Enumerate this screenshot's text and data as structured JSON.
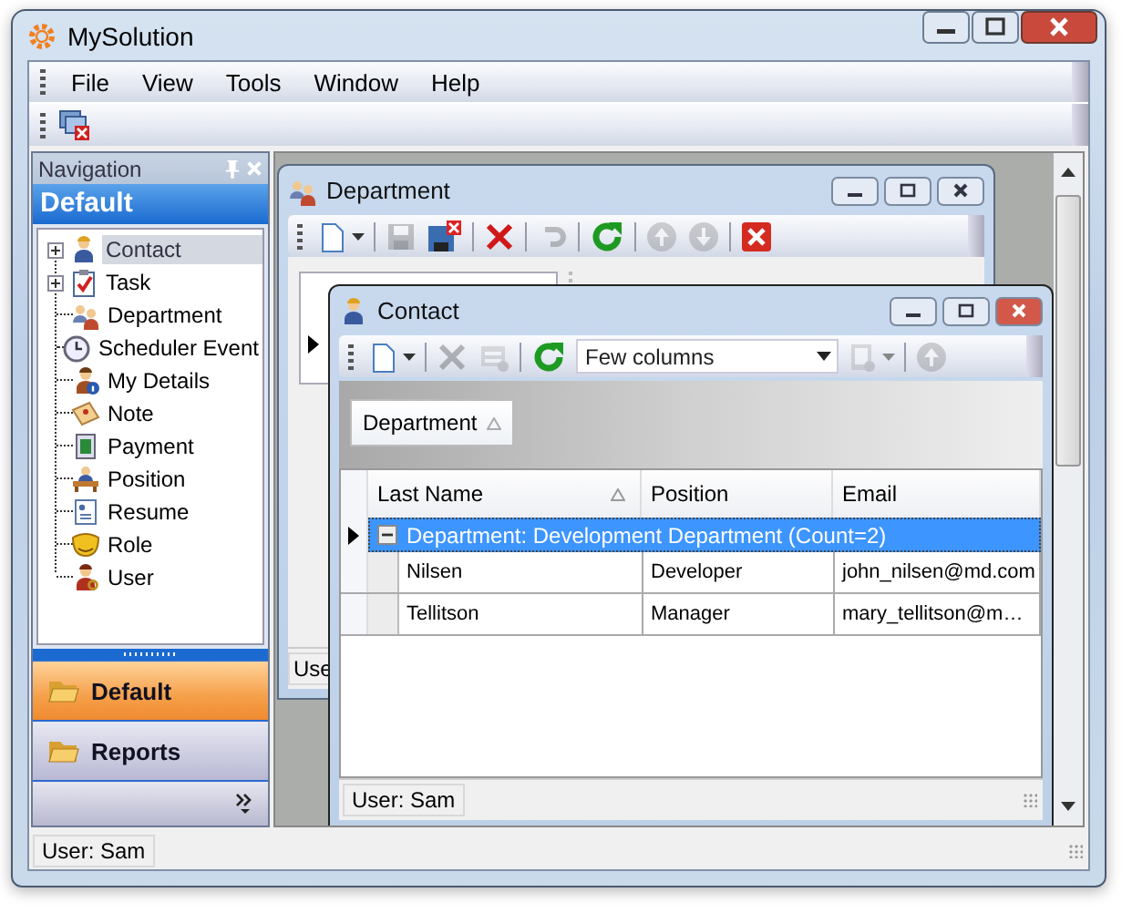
{
  "window": {
    "title": "MySolution"
  },
  "menu": [
    {
      "label": "File"
    },
    {
      "label": "View"
    },
    {
      "label": "Tools"
    },
    {
      "label": "Window"
    },
    {
      "label": "Help"
    }
  ],
  "toolbar": [
    {
      "kind": "close-windows",
      "disabled": false
    }
  ],
  "navigation": {
    "title": "Navigation",
    "group_title": "Default",
    "items": [
      {
        "label": "Contact",
        "kind": "branch",
        "selected": true
      },
      {
        "label": "Task",
        "kind": "branch",
        "selected": false
      },
      {
        "label": "Department",
        "kind": "leaf",
        "selected": false
      },
      {
        "label": "Scheduler Event",
        "kind": "leaf",
        "selected": false
      },
      {
        "label": "My Details",
        "kind": "leaf",
        "selected": false
      },
      {
        "label": "Note",
        "kind": "leaf",
        "selected": false
      },
      {
        "label": "Payment",
        "kind": "leaf",
        "selected": false
      },
      {
        "label": "Position",
        "kind": "leaf",
        "selected": false
      },
      {
        "label": "Resume",
        "kind": "leaf",
        "selected": false
      },
      {
        "label": "Role",
        "kind": "leaf",
        "selected": false
      },
      {
        "label": "User",
        "kind": "leaf",
        "selected": false
      }
    ],
    "groups": [
      {
        "label": "Default",
        "selected": true
      },
      {
        "label": "Reports",
        "selected": false
      }
    ]
  },
  "department_window": {
    "title": "Department",
    "status": "Use",
    "toolbar": [
      {
        "kind": "new",
        "disabled": false
      },
      {
        "kind": "save",
        "disabled": true
      },
      {
        "kind": "save-close",
        "disabled": false
      },
      {
        "kind": "delete",
        "disabled": false
      },
      {
        "kind": "undo",
        "disabled": true
      },
      {
        "kind": "refresh",
        "disabled": false
      },
      {
        "kind": "up",
        "disabled": true
      },
      {
        "kind": "down",
        "disabled": true
      },
      {
        "kind": "close",
        "disabled": false
      }
    ]
  },
  "contact_window": {
    "title": "Contact",
    "view": "Few columns",
    "toolbar": [
      {
        "kind": "new",
        "disabled": false
      },
      {
        "kind": "delete",
        "disabled": true
      },
      {
        "kind": "form",
        "disabled": true
      },
      {
        "kind": "refresh",
        "disabled": false
      },
      {
        "kind": "view",
        "disabled": false
      },
      {
        "kind": "clone",
        "disabled": true
      },
      {
        "kind": "up",
        "disabled": true
      }
    ],
    "group_panel": [
      {
        "label": "Department"
      }
    ],
    "columns": [
      {
        "label": "Last Name",
        "sorted": true
      },
      {
        "label": "Position",
        "sorted": false
      },
      {
        "label": "Email",
        "sorted": false
      }
    ],
    "group": {
      "label": "Department: Development Department (Count=2)",
      "expanded": true,
      "selected": true
    },
    "rows": [
      {
        "cells": [
          "Nilsen",
          "Developer",
          "john_nilsen@md.com"
        ]
      },
      {
        "cells": [
          "Tellitson",
          "Manager",
          "mary_tellitson@m…"
        ]
      }
    ],
    "status": "User: Sam"
  },
  "status_bar": "User: Sam"
}
